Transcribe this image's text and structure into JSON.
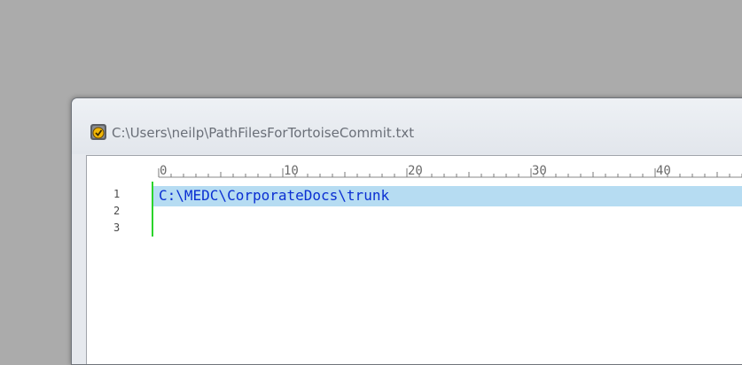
{
  "window": {
    "title": "C:\\Users\\neilp\\PathFilesForTortoiseCommit.txt",
    "icon": "notepad-app-icon"
  },
  "ruler": {
    "labels": [
      "0",
      "10",
      "20",
      "30",
      "40"
    ]
  },
  "editor": {
    "line_numbers": [
      "1",
      "2",
      "3"
    ],
    "lines": [
      "C:\\MEDC\\CorporateDocs\\trunk",
      "",
      ""
    ],
    "current_line": 1
  },
  "colors": {
    "desktop": "#ababab",
    "current_line_highlight": "#b6dcf2",
    "text": "#0a2fd2",
    "gutter_marker": "#2bd42b"
  }
}
